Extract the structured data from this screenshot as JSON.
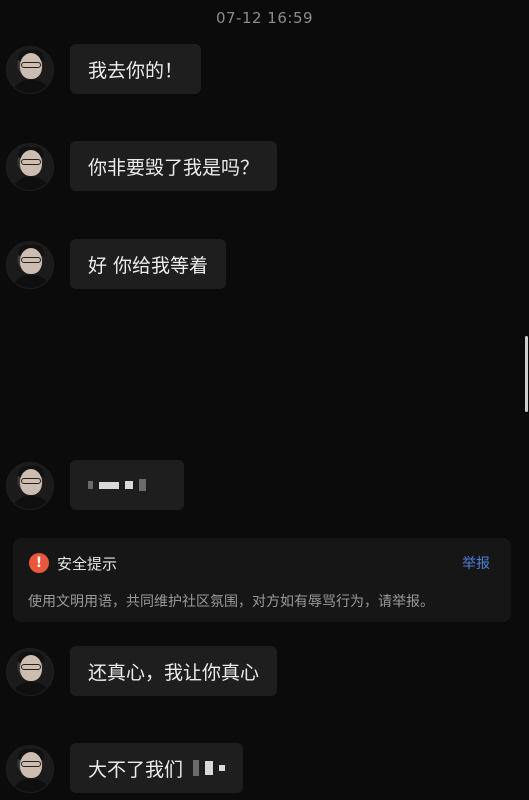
{
  "timestamp": "07-12 16:59",
  "messages": [
    {
      "text": "我去你的！"
    },
    {
      "text": "你非要毁了我是吗？"
    },
    {
      "text": "好 你给我等着"
    },
    {
      "text": ""
    },
    {
      "text": "还真心，我让你真心"
    },
    {
      "text": "大不了我们"
    }
  ],
  "safety_notice": {
    "icon": "warning-icon",
    "title": "安全提示",
    "report_label": "举报",
    "body": "使用文明用语，共同维护社区氛围，对方如有辱骂行为，请举报。",
    "icon_color": "#e9573c",
    "link_color": "#4d7fdc"
  }
}
